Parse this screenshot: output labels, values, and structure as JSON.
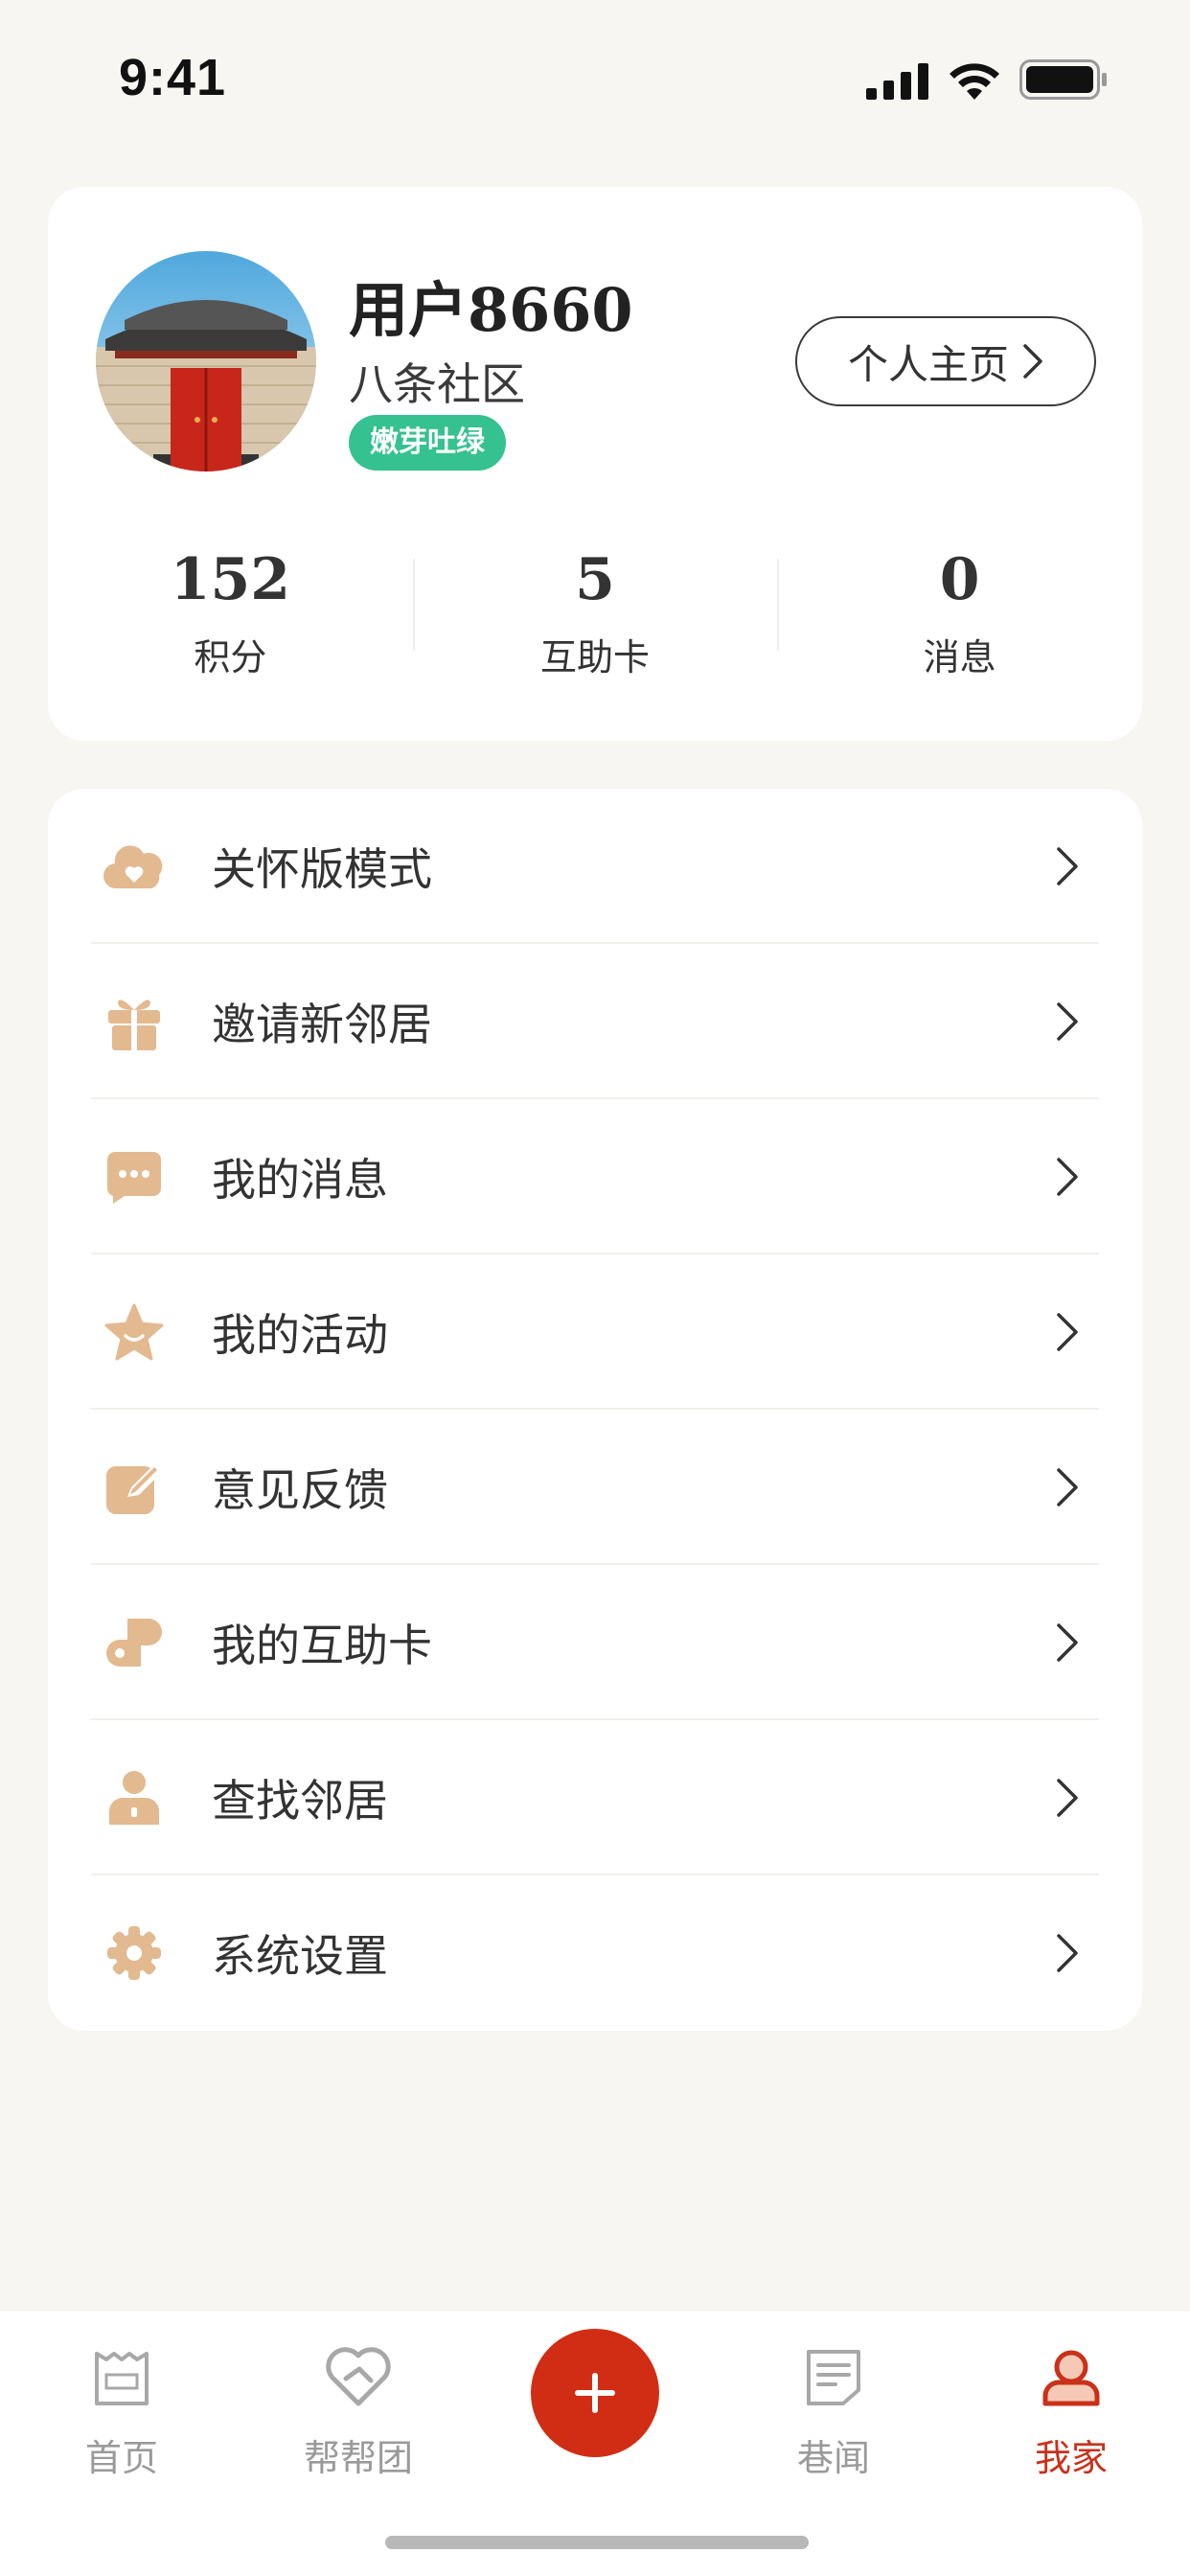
{
  "status_bar": {
    "time": "9:41"
  },
  "profile": {
    "username": "用户8660",
    "community": "八条社区",
    "level_badge": "嫩芽吐绿",
    "homepage_button": "个人主页",
    "stats": [
      {
        "value": "152",
        "label": "积分"
      },
      {
        "value": "5",
        "label": "互助卡"
      },
      {
        "value": "0",
        "label": "消息"
      }
    ]
  },
  "menu": [
    {
      "label": "关怀版模式",
      "icon": "heart-cloud-icon"
    },
    {
      "label": "邀请新邻居",
      "icon": "gift-icon"
    },
    {
      "label": "我的消息",
      "icon": "message-icon"
    },
    {
      "label": "我的活动",
      "icon": "star-icon"
    },
    {
      "label": "意见反馈",
      "icon": "edit-icon"
    },
    {
      "label": "我的互助卡",
      "icon": "card-icon"
    },
    {
      "label": "查找邻居",
      "icon": "person-icon"
    },
    {
      "label": "系统设置",
      "icon": "gear-icon"
    }
  ],
  "tabbar": {
    "tabs": [
      {
        "label": "首页",
        "icon": "home-icon"
      },
      {
        "label": "帮帮团",
        "icon": "heart-hand-icon"
      },
      {
        "label": "巷闻",
        "icon": "news-icon"
      },
      {
        "label": "我家",
        "icon": "profile-icon"
      }
    ],
    "active_index": 3
  },
  "colors": {
    "accent": "#d12d14",
    "icon_tan": "#e3b990",
    "badge_green": "#35c190",
    "background": "#f7f6f3"
  }
}
